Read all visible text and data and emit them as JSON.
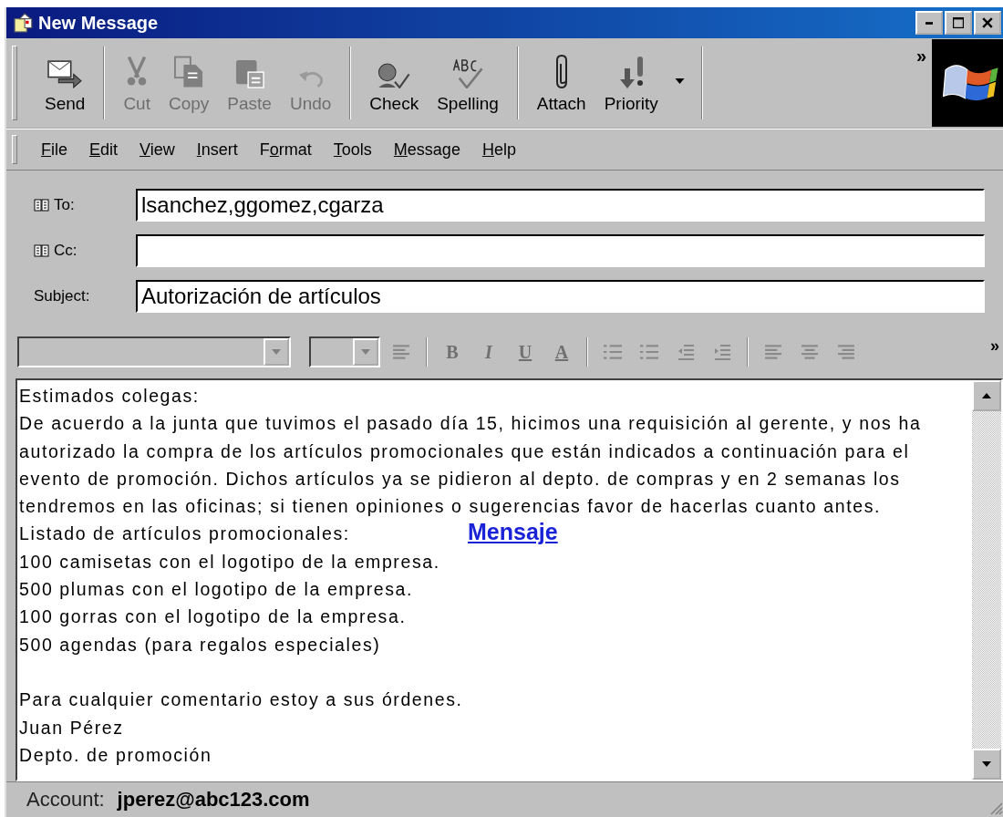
{
  "window": {
    "title": "New Message"
  },
  "toolbar": [
    {
      "label": "Send",
      "disabled": false
    },
    {
      "label": "Cut",
      "disabled": true
    },
    {
      "label": "Copy",
      "disabled": true
    },
    {
      "label": "Paste",
      "disabled": true
    },
    {
      "label": "Undo",
      "disabled": true
    },
    {
      "label": "Check",
      "disabled": false
    },
    {
      "label": "Spelling",
      "disabled": false
    },
    {
      "label": "Attach",
      "disabled": false
    },
    {
      "label": "Priority",
      "disabled": false
    }
  ],
  "toolbar_more": "»",
  "menu": [
    {
      "key": "F",
      "after": "ile"
    },
    {
      "key": "E",
      "after": "dit"
    },
    {
      "key": "V",
      "after": "iew"
    },
    {
      "key": "I",
      "after": "nsert"
    },
    {
      "before": "F",
      "key": "o",
      "after": "rmat"
    },
    {
      "key": "T",
      "after": "ools"
    },
    {
      "key": "M",
      "after": "essage"
    },
    {
      "key": "H",
      "after": "elp"
    }
  ],
  "fields": [
    {
      "label": "To:",
      "address_book": true,
      "value": "lsanchez,ggomez,cgarza"
    },
    {
      "label": "Cc:",
      "address_book": true
    },
    {
      "label": "Subject:",
      "address_book": false,
      "value": "Autorización de artículos"
    }
  ],
  "format_toolbar": {
    "disabled": true,
    "letters": [
      "B",
      "I",
      "U",
      "A"
    ],
    "more": "»"
  },
  "body": {
    "lines": [
      "Estimados colegas:",
      "De acuerdo a la junta que tuvimos el pasado día 15, hicimos una requisición al gerente, y nos ha",
      "autorizado la compra de los artículos promocionales que están indicados a continuación para el",
      "evento de promoción. Dichos artículos ya se pidieron al depto. de compras y en 2 semanas los",
      "tendremos en las oficinas; si tienen opiniones o sugerencias  favor de hacerlas cuanto antes.",
      "Listado de artículos promocionales:",
      "100 camisetas con el logotipo de la empresa.",
      "500 plumas con el logotipo de la empresa.",
      "100 gorras con el logotipo de la empresa.",
      "500 agendas (para regalos especiales)"
    ],
    "closing": [
      "Para cualquier comentario estoy a sus órdenes.",
      "Juan Pérez",
      "Depto. de  promoción"
    ],
    "overlay_link": "Mensaje"
  },
  "status_bar": {
    "label": "Account:",
    "account": "jperez@abc123.com"
  }
}
